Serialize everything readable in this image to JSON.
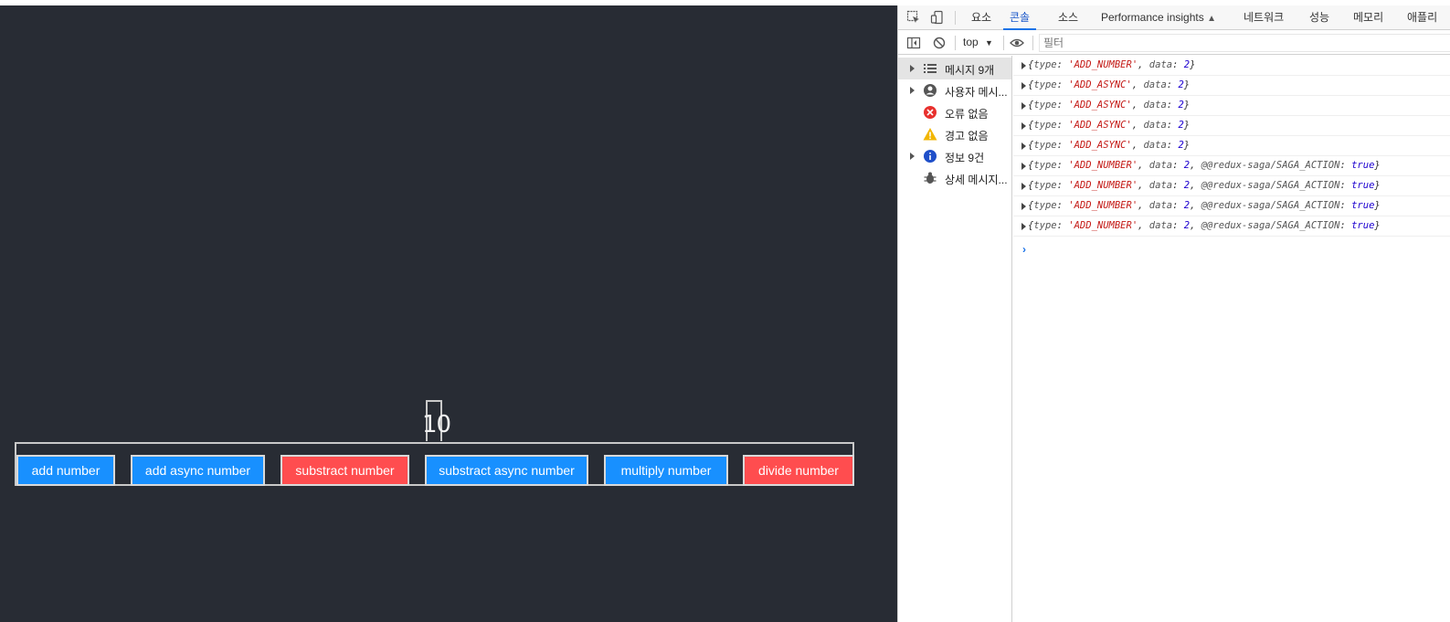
{
  "app": {
    "counter": "10",
    "buttons": [
      {
        "label": "add number",
        "color": "#1890ff"
      },
      {
        "label": "add async number",
        "color": "#1890ff"
      },
      {
        "label": "substract number",
        "color": "#ff4d4f"
      },
      {
        "label": "substract async number",
        "color": "#1890ff"
      },
      {
        "label": "multiply number",
        "color": "#1890ff"
      },
      {
        "label": "divide number",
        "color": "#ff4d4f"
      }
    ]
  },
  "devtools": {
    "tabs": [
      "요소",
      "콘솔",
      "소스",
      "Performance insights",
      "네트워크",
      "성능",
      "메모리",
      "애플리"
    ],
    "active_tab": "콘솔",
    "context": "top",
    "filter_placeholder": "필터",
    "sidebar": [
      {
        "label": "메시지 9개",
        "icon": "list-icon",
        "expandable": true
      },
      {
        "label": "사용자 메시...",
        "icon": "user-icon",
        "expandable": true
      },
      {
        "label": "오류 없음",
        "icon": "error-icon",
        "expandable": false
      },
      {
        "label": "경고 없음",
        "icon": "warning-icon",
        "expandable": false
      },
      {
        "label": "정보 9건",
        "icon": "info-icon",
        "expandable": true
      },
      {
        "label": "상세 메시지...",
        "icon": "bug-icon",
        "expandable": false
      }
    ],
    "logs": [
      {
        "type": "'ADD_NUMBER'",
        "data": "2",
        "saga": false
      },
      {
        "type": "'ADD_ASYNC'",
        "data": "2",
        "saga": false
      },
      {
        "type": "'ADD_ASYNC'",
        "data": "2",
        "saga": false
      },
      {
        "type": "'ADD_ASYNC'",
        "data": "2",
        "saga": false
      },
      {
        "type": "'ADD_ASYNC'",
        "data": "2",
        "saga": false
      },
      {
        "type": "'ADD_NUMBER'",
        "data": "2",
        "saga": true
      },
      {
        "type": "'ADD_NUMBER'",
        "data": "2",
        "saga": true
      },
      {
        "type": "'ADD_NUMBER'",
        "data": "2",
        "saga": true
      },
      {
        "type": "'ADD_NUMBER'",
        "data": "2",
        "saga": true
      }
    ],
    "log_labels": {
      "type_key": "type",
      "data_key": "data",
      "saga_key": "@@redux-saga/SAGA_ACTION",
      "saga_val": "true"
    },
    "prompt": "›"
  }
}
